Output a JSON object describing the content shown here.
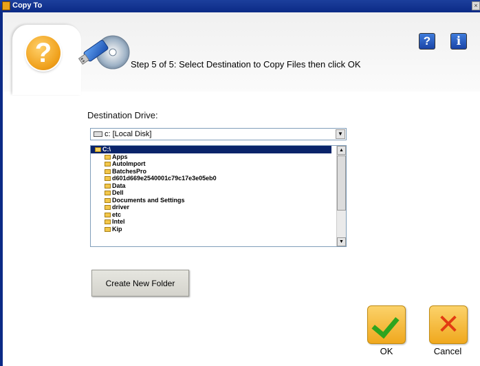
{
  "window": {
    "title": "Copy To",
    "close_glyph": "×"
  },
  "header": {
    "step_text": "Step 5 of 5: Select Destination to Copy Files then click OK",
    "question_glyph": "?",
    "help_glyph": "?",
    "info_glyph": "i"
  },
  "icons": {
    "wizard": "question-circle-icon",
    "usb": "usb-drive-disc-icon",
    "help": "help-icon",
    "info": "info-icon"
  },
  "destination": {
    "label": "Destination Drive:",
    "selected_drive": "c: [Local Disk]"
  },
  "folders": [
    {
      "name": "C:\\",
      "selected": true,
      "root": true
    },
    {
      "name": "Apps"
    },
    {
      "name": "AutoImport"
    },
    {
      "name": "BatchesPro"
    },
    {
      "name": "d601d669e2540001c79c17e3e05eb0"
    },
    {
      "name": "Data"
    },
    {
      "name": "Dell"
    },
    {
      "name": "Documents and Settings"
    },
    {
      "name": "driver"
    },
    {
      "name": "etc"
    },
    {
      "name": "Intel"
    },
    {
      "name": "Kip"
    }
  ],
  "buttons": {
    "create_folder": "Create New Folder",
    "ok": "OK",
    "cancel": "Cancel",
    "cancel_glyph": "✕"
  },
  "colors": {
    "titlebar": "#0b2a86",
    "selection": "#0a246a",
    "accent_orange": "#f0a81e",
    "ok_green": "#2ea41f",
    "cancel_red": "#e23b12"
  }
}
